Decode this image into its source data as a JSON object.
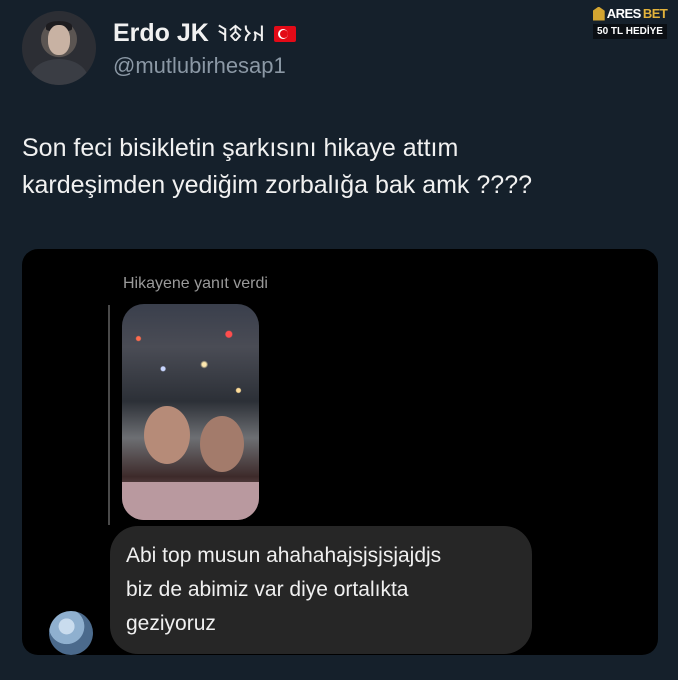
{
  "tweet": {
    "author_name": "Erdo JK",
    "author_runes": "𐰴𐰆𐱃𐰚",
    "author_flag": "turkey-flag",
    "handle": "@mutlubirhesap1",
    "text_line1": "Son feci bisikletin şarkısını hikaye attım",
    "text_line2": "kardeşimden yediğim zorbalığa bak amk ????"
  },
  "watermark": {
    "brand_a": "ARES",
    "brand_b": "BET",
    "tag": "50 TL HEDİYE",
    "color": "#e2b23b"
  },
  "dm_screenshot": {
    "reply_label": "Hikayene yanıt verdi",
    "message_lines": [
      "Abi top musun ahahahajsjsjsjajdjs",
      "biz de abimiz var diye ortalıkta",
      "geziyoruz"
    ]
  },
  "colors": {
    "background": "#15202b",
    "dm_background": "#000000",
    "bubble": "#262626"
  }
}
